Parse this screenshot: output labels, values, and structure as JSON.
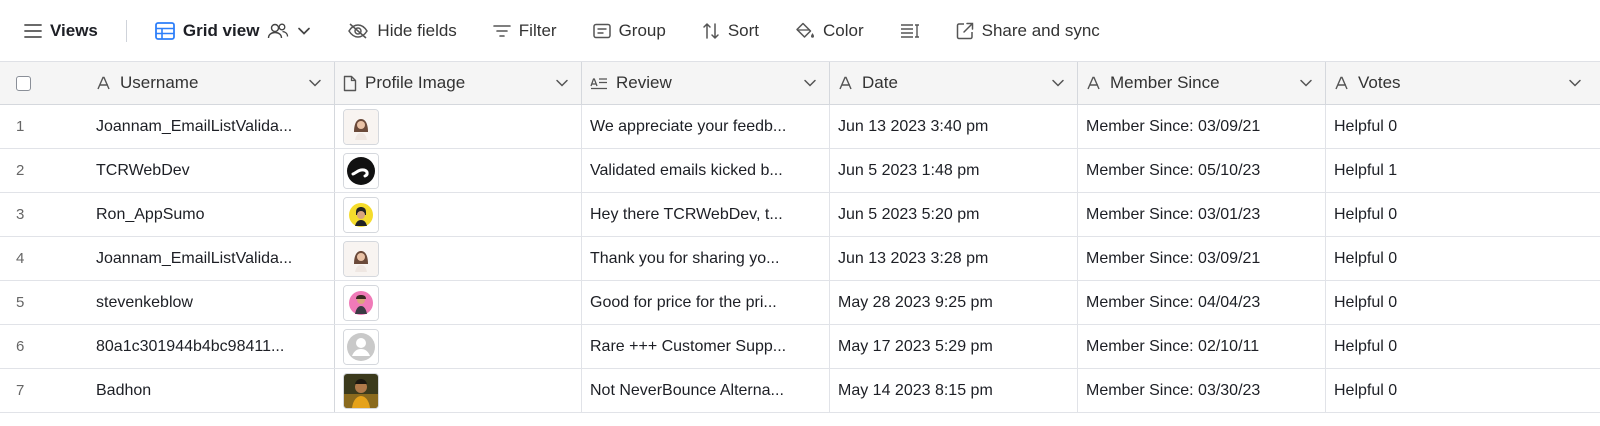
{
  "toolbar": {
    "views_label": "Views",
    "grid_view_label": "Grid view",
    "hide_fields_label": "Hide fields",
    "filter_label": "Filter",
    "group_label": "Group",
    "sort_label": "Sort",
    "color_label": "Color",
    "share_label": "Share and sync"
  },
  "columns": {
    "username": "Username",
    "profile_image": "Profile Image",
    "review": "Review",
    "date": "Date",
    "member_since": "Member Since",
    "votes": "Votes"
  },
  "rows": [
    {
      "num": "1",
      "username": "Joannam_EmailListValida...",
      "avatar": "woman-portrait",
      "review": "We appreciate your feedb...",
      "date": "Jun 13 2023 3:40 pm",
      "member": "Member Since: 03/09/21",
      "votes": "Helpful 0"
    },
    {
      "num": "2",
      "username": "TCRWebDev",
      "avatar": "black-logo",
      "review": "Validated emails kicked b...",
      "date": "Jun 5 2023 1:48 pm",
      "member": "Member Since: 05/10/23",
      "votes": "Helpful 1"
    },
    {
      "num": "3",
      "username": "Ron_AppSumo",
      "avatar": "yellow-man",
      "review": "Hey there TCRWebDev, t...",
      "date": "Jun 5 2023 5:20 pm",
      "member": "Member Since: 03/01/23",
      "votes": "Helpful 0"
    },
    {
      "num": "4",
      "username": "Joannam_EmailListValida...",
      "avatar": "woman-portrait",
      "review": "Thank you for sharing yo...",
      "date": "Jun 13 2023 3:28 pm",
      "member": "Member Since: 03/09/21",
      "votes": "Helpful 0"
    },
    {
      "num": "5",
      "username": "stevenkeblow",
      "avatar": "pink-man",
      "review": "Good for price for the pri...",
      "date": "May 28 2023 9:25 pm",
      "member": "Member Since: 04/04/23",
      "votes": "Helpful 0"
    },
    {
      "num": "6",
      "username": "80a1c301944b4bc98411...",
      "avatar": "default-user",
      "review": "Rare +++ Customer Supp...",
      "date": "May 17 2023 5:29 pm",
      "member": "Member Since: 02/10/11",
      "votes": "Helpful 0"
    },
    {
      "num": "7",
      "username": "Badhon",
      "avatar": "photo",
      "review": "Not NeverBounce Alterna...",
      "date": "May 14 2023 8:15 pm",
      "member": "Member Since: 03/30/23",
      "votes": "Helpful 0"
    }
  ],
  "colors": {
    "header_bg": "#f5f5f5",
    "grid_line": "#e1e3e8",
    "accent_blue": "#2d7ff9"
  }
}
